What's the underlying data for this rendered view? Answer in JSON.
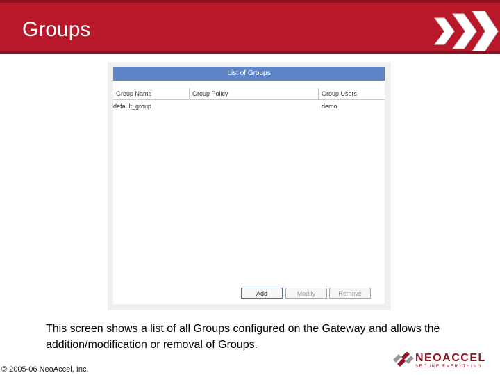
{
  "slide": {
    "title": "Groups",
    "description": "This screen shows a list of all Groups configured on the Gateway and allows the addition/modification or removal of Groups.",
    "copyright": "© 2005-06 NeoAccel, Inc."
  },
  "list": {
    "header": "List of Groups",
    "columns": [
      "Group Name",
      "Group Policy",
      "Group Users"
    ],
    "rows": [
      {
        "group_name": "default_group",
        "group_policy": "",
        "group_users": "demo"
      }
    ]
  },
  "buttons": {
    "add": "Add",
    "modify": "Modify",
    "remove": "Remove"
  },
  "logo": {
    "name": "NEOACCEL",
    "tagline": "SECURE EVERYTHING"
  },
  "colors": {
    "title_bar": "#b7182a",
    "list_header": "#5f85c9",
    "brand": "#8f1320"
  },
  "icons": [
    "chevrons-icon",
    "neoaccel-logo-icon"
  ]
}
